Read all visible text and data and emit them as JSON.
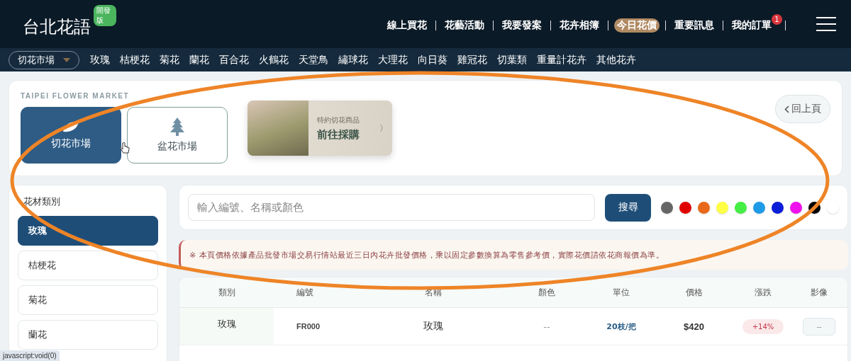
{
  "header": {
    "logo": "台北花語",
    "logo_badge": "開發版",
    "links": [
      {
        "label": "線上買花",
        "selected": false
      },
      {
        "label": "花藝活動",
        "selected": false
      },
      {
        "label": "我要發案",
        "selected": false
      },
      {
        "label": "花卉相簿",
        "selected": false
      },
      {
        "label": "今日花價",
        "selected": true
      },
      {
        "label": "重要訊息",
        "selected": false
      },
      {
        "label": "我的訂單",
        "selected": false,
        "badge": "1"
      }
    ]
  },
  "category_nav": {
    "dropdown": "切花市場",
    "items": [
      "玫瑰",
      "桔梗花",
      "菊花",
      "蘭花",
      "百合花",
      "火鶴花",
      "天堂鳥",
      "繡球花",
      "大理花",
      "向日葵",
      "雞冠花",
      "切葉類",
      "重量計花卉",
      "其他花卉"
    ]
  },
  "market_panel": {
    "eyebrow": "TAIPEI FLOWER MARKET",
    "markets": [
      {
        "label": "切花市場",
        "kind": "cut",
        "selected": true
      },
      {
        "label": "盆花市場",
        "kind": "potted",
        "selected": false
      }
    ],
    "promo": {
      "caption": "特約切花商品",
      "title": "前往採購",
      "arrow": "〉"
    },
    "back_button": "回上頁"
  },
  "sidebar": {
    "title": "花材類別",
    "items": [
      {
        "label": "玫瑰",
        "selected": true
      },
      {
        "label": "桔梗花",
        "selected": false
      },
      {
        "label": "菊花",
        "selected": false
      },
      {
        "label": "蘭花",
        "selected": false
      }
    ]
  },
  "search": {
    "placeholder": "輸入編號、名稱或顏色",
    "button": "搜尋",
    "colors": [
      {
        "color": "#666666",
        "selected": false
      },
      {
        "color": "#e00000",
        "selected": false
      },
      {
        "color": "#e8691a",
        "selected": false
      },
      {
        "color": "#ffff44",
        "selected": false
      },
      {
        "color": "#44ee44",
        "selected": false
      },
      {
        "color": "#1e9be8",
        "selected": false
      },
      {
        "color": "#0a1ed8",
        "selected": false
      },
      {
        "color": "#ee11ee",
        "selected": false
      },
      {
        "color": "#000000",
        "selected": false
      },
      {
        "color": "#ffffff",
        "selected": false
      }
    ]
  },
  "notice": "※ 本頁價格依據產品批發市場交易行情站最近三日內花卉批發價格，乘以固定參數換算為零售參考價，實際花價請依花商報價為準。",
  "table": {
    "columns": [
      "類別",
      "編號",
      "名稱",
      "顏色",
      "單位",
      "價格",
      "漲跌",
      "影像"
    ],
    "rows": [
      {
        "category": "玫瑰",
        "code": "FR000",
        "name": "玫瑰",
        "colour_text": "--",
        "unit": "20枝/把",
        "price": "$420",
        "change": "+14%",
        "image": "--"
      }
    ]
  },
  "status_url": "javascript:void(0)"
}
